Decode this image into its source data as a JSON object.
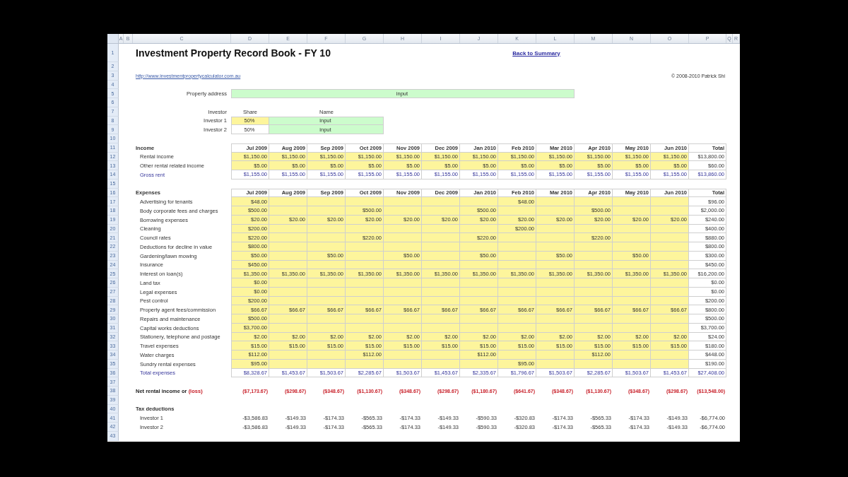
{
  "column_letters": [
    "A",
    "B",
    "C",
    "D",
    "E",
    "F",
    "G",
    "H",
    "I",
    "J",
    "K",
    "L",
    "M",
    "N",
    "O",
    "P",
    "Q",
    "R"
  ],
  "row_numbers": [
    "1",
    "2",
    "3",
    "4",
    "5",
    "6",
    "7",
    "8",
    "9",
    "10",
    "11",
    "12",
    "13",
    "14",
    "15",
    "16",
    "17",
    "18",
    "19",
    "20",
    "21",
    "22",
    "23",
    "24",
    "25",
    "26",
    "27",
    "28",
    "29",
    "30",
    "31",
    "32",
    "33",
    "34",
    "35",
    "36",
    "37",
    "38",
    "39",
    "40",
    "41",
    "42",
    "43"
  ],
  "title": "Investment Property Record Book - FY 10",
  "back_link": "Back to Summary",
  "website": "http://www.investmentpropertycalculator.com.au",
  "copyright": "© 2008-2010 Patrick Shi",
  "property": {
    "label": "Property address",
    "value": "input"
  },
  "investors": {
    "columns": [
      "Investor",
      "Share",
      "Name"
    ],
    "rows": [
      {
        "label": "Investor 1",
        "share": "50%",
        "share_editable": true,
        "name": "input"
      },
      {
        "label": "Investor 2",
        "share": "50%",
        "share_editable": false,
        "name": "input"
      }
    ]
  },
  "income": {
    "heading": "Income",
    "months": [
      "Jul 2009",
      "Aug 2009",
      "Sep 2009",
      "Oct 2009",
      "Nov 2009",
      "Dec 2009",
      "Jan 2010",
      "Feb 2010",
      "Mar 2010",
      "Apr 2010",
      "May 2010",
      "Jun 2010"
    ],
    "total_heading": "Total",
    "rows": [
      {
        "label": "Rental income",
        "kind": "input",
        "values": [
          "$1,150.00",
          "$1,150.00",
          "$1,150.00",
          "$1,150.00",
          "$1,150.00",
          "$1,150.00",
          "$1,150.00",
          "$1,150.00",
          "$1,150.00",
          "$1,150.00",
          "$1,150.00",
          "$1,150.00"
        ],
        "total": "$13,800.00"
      },
      {
        "label": "Other rental related income",
        "kind": "input",
        "values": [
          "$5.00",
          "$5.00",
          "$5.00",
          "$5.00",
          "$5.00",
          "$5.00",
          "$5.00",
          "$5.00",
          "$5.00",
          "$5.00",
          "$5.00",
          "$5.00"
        ],
        "total": "$60.00"
      },
      {
        "label": "Gross rent",
        "kind": "total",
        "values": [
          "$1,155.00",
          "$1,155.00",
          "$1,155.00",
          "$1,155.00",
          "$1,155.00",
          "$1,155.00",
          "$1,155.00",
          "$1,155.00",
          "$1,155.00",
          "$1,155.00",
          "$1,155.00",
          "$1,155.00"
        ],
        "total": "$13,860.00"
      }
    ]
  },
  "expenses": {
    "heading": "Expenses",
    "months": [
      "Jul 2009",
      "Aug 2009",
      "Sep 2009",
      "Oct 2009",
      "Nov 2009",
      "Dec 2009",
      "Jan 2010",
      "Feb 2010",
      "Mar 2010",
      "Apr 2010",
      "May 2010",
      "Jun 2010"
    ],
    "total_heading": "Total",
    "rows": [
      {
        "label": "Advertising for tenants",
        "kind": "input",
        "values": {
          "D": "$48.00",
          "K": "$48.00"
        },
        "total": "$96.00"
      },
      {
        "label": "Body corporate fees and charges",
        "kind": "input",
        "values": {
          "D": "$500.00",
          "G": "$500.00",
          "J": "$500.00",
          "M": "$500.00"
        },
        "total": "$2,000.00"
      },
      {
        "label": "Borrowing expenses",
        "kind": "input",
        "values": [
          "$20.00",
          "$20.00",
          "$20.00",
          "$20.00",
          "$20.00",
          "$20.00",
          "$20.00",
          "$20.00",
          "$20.00",
          "$20.00",
          "$20.00",
          "$20.00"
        ],
        "total": "$240.00"
      },
      {
        "label": "Cleaning",
        "kind": "input",
        "values": {
          "D": "$200.00",
          "K": "$200.00"
        },
        "total": "$400.00"
      },
      {
        "label": "Council rates",
        "kind": "input",
        "values": {
          "D": "$220.00",
          "G": "$220.00",
          "J": "$220.00",
          "M": "$220.00"
        },
        "total": "$880.00"
      },
      {
        "label": "Deductions for decline in value",
        "kind": "input",
        "values": {
          "D": "$800.00"
        },
        "total": "$800.00"
      },
      {
        "label": "Gardening/lawn mowing",
        "kind": "input",
        "values": {
          "D": "$50.00",
          "F": "$50.00",
          "H": "$50.00",
          "J": "$50.00",
          "L": "$50.00",
          "N": "$50.00"
        },
        "total": "$300.00"
      },
      {
        "label": "Insurance",
        "kind": "input",
        "values": {
          "D": "$450.00"
        },
        "total": "$450.00"
      },
      {
        "label": "Interest on loan(s)",
        "kind": "input",
        "values": [
          "$1,350.00",
          "$1,350.00",
          "$1,350.00",
          "$1,350.00",
          "$1,350.00",
          "$1,350.00",
          "$1,350.00",
          "$1,350.00",
          "$1,350.00",
          "$1,350.00",
          "$1,350.00",
          "$1,350.00"
        ],
        "total": "$16,200.00"
      },
      {
        "label": "Land tax",
        "kind": "input",
        "values": {
          "D": "$0.00"
        },
        "total": "$0.00"
      },
      {
        "label": "Legal expenses",
        "kind": "input",
        "values": {
          "D": "$0.00"
        },
        "total": "$0.00"
      },
      {
        "label": "Pest control",
        "kind": "input",
        "values": {
          "D": "$200.00"
        },
        "total": "$200.00"
      },
      {
        "label": "Property agent fees/commission",
        "kind": "input",
        "values": [
          "$66.67",
          "$66.67",
          "$66.67",
          "$66.67",
          "$66.67",
          "$66.67",
          "$66.67",
          "$66.67",
          "$66.67",
          "$66.67",
          "$66.67",
          "$66.67"
        ],
        "total": "$800.00"
      },
      {
        "label": "Repairs and maintenance",
        "kind": "input",
        "values": {
          "D": "$500.00"
        },
        "total": "$500.00"
      },
      {
        "label": "Capital works deductions",
        "kind": "input",
        "values": {
          "D": "$3,700.00"
        },
        "total": "$3,700.00"
      },
      {
        "label": "Stationery, telephone and postage",
        "kind": "input",
        "values": [
          "$2.00",
          "$2.00",
          "$2.00",
          "$2.00",
          "$2.00",
          "$2.00",
          "$2.00",
          "$2.00",
          "$2.00",
          "$2.00",
          "$2.00",
          "$2.00"
        ],
        "total": "$24.00"
      },
      {
        "label": "Travel expenses",
        "kind": "input",
        "values": [
          "$15.00",
          "$15.00",
          "$15.00",
          "$15.00",
          "$15.00",
          "$15.00",
          "$15.00",
          "$15.00",
          "$15.00",
          "$15.00",
          "$15.00",
          "$15.00"
        ],
        "total": "$180.00"
      },
      {
        "label": "Water charges",
        "kind": "input",
        "values": {
          "D": "$112.00",
          "G": "$112.00",
          "J": "$112.00",
          "M": "$112.00"
        },
        "total": "$448.00"
      },
      {
        "label": "Sundry rental expenses",
        "kind": "input",
        "values": {
          "D": "$95.00",
          "K": "$95.00"
        },
        "total": "$190.00"
      },
      {
        "label": "Total expenses",
        "kind": "total",
        "values": [
          "$8,328.67",
          "$1,453.67",
          "$1,503.67",
          "$2,285.67",
          "$1,503.67",
          "$1,453.67",
          "$2,335.67",
          "$1,796.67",
          "$1,503.67",
          "$2,285.67",
          "$1,503.67",
          "$1,453.67"
        ],
        "total": "$27,408.00"
      }
    ]
  },
  "net": {
    "label": "Net rental income or",
    "loss_label": "(loss)",
    "values": [
      "($7,173.67)",
      "($298.67)",
      "($348.67)",
      "($1,130.67)",
      "($348.67)",
      "($298.67)",
      "($1,180.67)",
      "($641.67)",
      "($348.67)",
      "($1,130.67)",
      "($348.67)",
      "($298.67)"
    ],
    "total": "($13,548.00)"
  },
  "tax_deductions": {
    "heading": "Tax deductions",
    "rows": [
      {
        "label": "Investor 1",
        "values": [
          "-$3,586.83",
          "-$149.33",
          "-$174.33",
          "-$565.33",
          "-$174.33",
          "-$149.33",
          "-$590.33",
          "-$320.83",
          "-$174.33",
          "-$565.33",
          "-$174.33",
          "-$149.33"
        ],
        "total": "-$6,774.00"
      },
      {
        "label": "Investor 2",
        "values": [
          "-$3,586.83",
          "-$149.33",
          "-$174.33",
          "-$565.33",
          "-$174.33",
          "-$149.33",
          "-$590.33",
          "-$320.83",
          "-$174.33",
          "-$565.33",
          "-$174.33",
          "-$149.33"
        ],
        "total": "-$6,774.00"
      }
    ]
  }
}
